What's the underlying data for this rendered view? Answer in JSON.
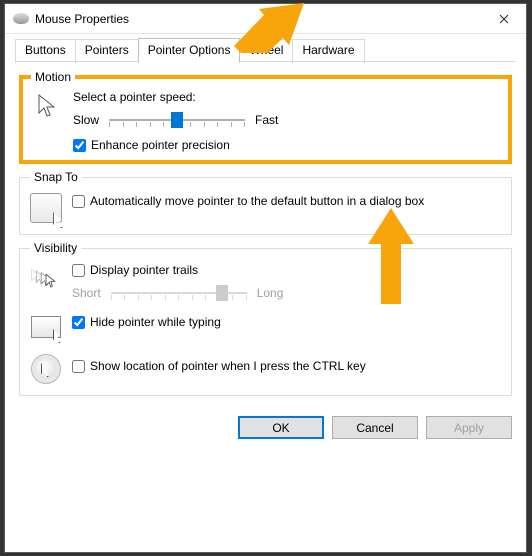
{
  "window": {
    "title": "Mouse Properties"
  },
  "tabs": [
    {
      "label": "Buttons",
      "active": false
    },
    {
      "label": "Pointers",
      "active": false
    },
    {
      "label": "Pointer Options",
      "active": true
    },
    {
      "label": "Wheel",
      "active": false
    },
    {
      "label": "Hardware",
      "active": false
    }
  ],
  "motion": {
    "legend": "Motion",
    "speed_label": "Select a pointer speed:",
    "slow": "Slow",
    "fast": "Fast",
    "slider_value": 6,
    "slider_max": 11,
    "enhance": {
      "checked": true,
      "label": "Enhance pointer precision"
    }
  },
  "snap": {
    "legend": "Snap To",
    "auto": {
      "checked": false,
      "label": "Automatically move pointer to the default button in a dialog box"
    }
  },
  "visibility": {
    "legend": "Visibility",
    "trails": {
      "checked": false,
      "label": "Display pointer trails",
      "short": "Short",
      "long": "Long",
      "slider_value": 9,
      "slider_max": 11
    },
    "hide": {
      "checked": true,
      "label": "Hide pointer while typing"
    },
    "ctrl": {
      "checked": false,
      "label": "Show location of pointer when I press the CTRL key"
    }
  },
  "buttons": {
    "ok": "OK",
    "cancel": "Cancel",
    "apply": "Apply"
  },
  "annotations": {
    "highlight_group": "motion",
    "arrows": [
      "tab-pointer-options",
      "motion-group-bottom"
    ]
  }
}
